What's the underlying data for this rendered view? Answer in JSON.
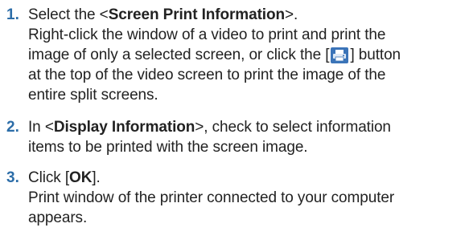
{
  "steps": [
    {
      "number": "1.",
      "lead_before": "Select the <",
      "lead_bold": "Screen Print Information",
      "lead_after": ">.",
      "desc_line1": "Right-click the window of a video to print and print the",
      "desc_line2": "image of only a selected screen, or click the [",
      "desc_line2_after": "] button",
      "desc_line3": "at the top of the video screen to print the image of the",
      "desc_line4": "entire split screens."
    },
    {
      "number": "2.",
      "lead_before": "In <",
      "lead_bold": "Display Information",
      "lead_after": ">, check to select information",
      "desc_line1": "items to be printed with the screen image."
    },
    {
      "number": "3.",
      "lead_before": "Click [",
      "lead_bold": "OK",
      "lead_after": "].",
      "desc_line1": "Print window of the printer connected to your computer",
      "desc_line2": "appears."
    }
  ],
  "icons": {
    "print_button": "printer-icon"
  }
}
